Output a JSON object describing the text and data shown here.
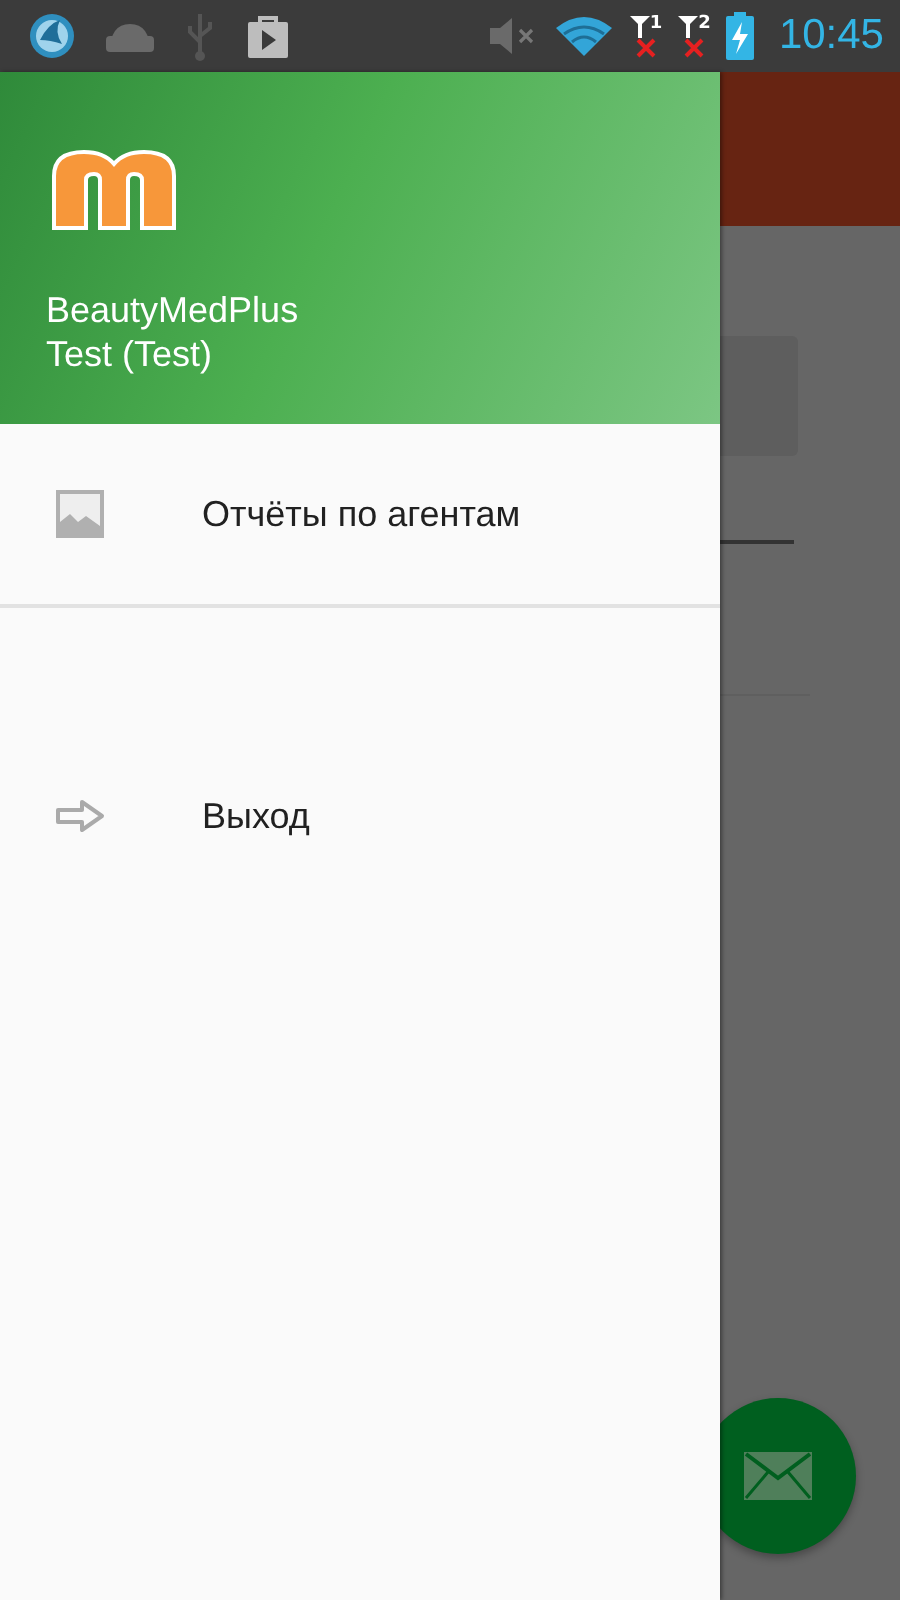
{
  "status_bar": {
    "time": "10:45",
    "sims": [
      {
        "label": "1",
        "connected": false
      },
      {
        "label": "2",
        "connected": false
      }
    ]
  },
  "drawer": {
    "header": {
      "title": "BeautyMedPlus",
      "subtitle": "Test (Test)"
    },
    "items": [
      {
        "label": "Отчёты по агентам",
        "kind": "image"
      },
      {
        "label": "Выход",
        "kind": "exit"
      }
    ]
  }
}
